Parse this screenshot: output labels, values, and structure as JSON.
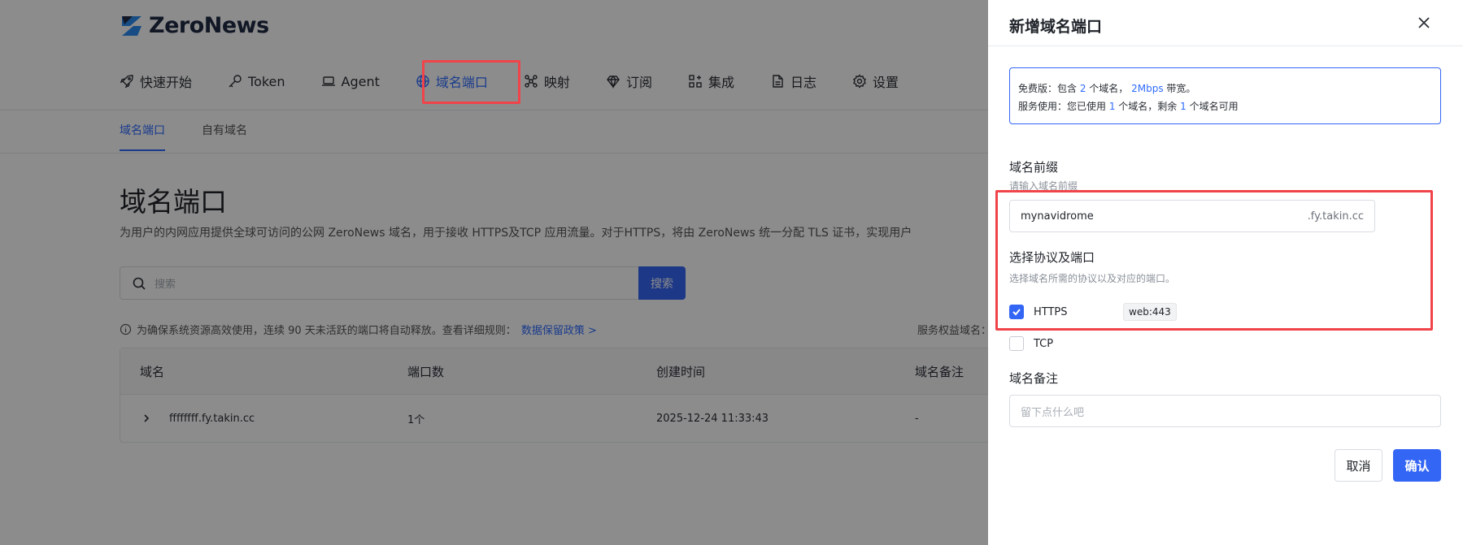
{
  "brand": {
    "name": "ZeroNews"
  },
  "nav": {
    "items": [
      {
        "label": "快速开始",
        "icon": "rocket-icon"
      },
      {
        "label": "Token",
        "icon": "key-icon"
      },
      {
        "label": "Agent",
        "icon": "laptop-icon"
      },
      {
        "label": "域名端口",
        "icon": "globe-icon",
        "active": true
      },
      {
        "label": "映射",
        "icon": "network-icon"
      },
      {
        "label": "订阅",
        "icon": "diamond-icon"
      },
      {
        "label": "集成",
        "icon": "apps-icon"
      },
      {
        "label": "日志",
        "icon": "file-icon"
      },
      {
        "label": "设置",
        "icon": "gear-icon"
      }
    ]
  },
  "subtabs": [
    "域名端口",
    "自有域名"
  ],
  "main": {
    "title": "域名端口",
    "description": "为用户的内网应用提供全球可访问的公网 ZeroNews 域名，用于接收 HTTPS及TCP 应用流量。对于HTTPS，将由 ZeroNews 统一分配 TLS 证书，实现用户",
    "search_placeholder": "搜索",
    "search_button": "搜索",
    "notice": "为确保系统资源高效使用，连续 90 天未活跃的端口将自动释放。查看详细规则：",
    "notice_link": "数据保留政策 >",
    "service_right": "服务权益域名："
  },
  "table": {
    "headers": [
      "域名",
      "端口数",
      "创建时间",
      "域名备注"
    ],
    "rows": [
      {
        "domain": "ffffffff.fy.takin.cc",
        "ports": "1个",
        "created": "2025-12-24 11:33:43",
        "remark": "-"
      }
    ]
  },
  "drawer": {
    "title": "新增域名端口",
    "info_line1": {
      "a": "免费版：包含 ",
      "b": "2",
      "c": " 个域名， ",
      "d": "2Mbps",
      "e": " 带宽。"
    },
    "info_line2": {
      "a": "服务使用：您已使用 ",
      "b": "1",
      "c": " 个域名，剩余 ",
      "d": "1",
      "e": " 个域名可用"
    },
    "prefix_label": "域名前缀",
    "prefix_hint": "请输入域名前缀",
    "prefix_value": "mynavidrome",
    "prefix_suffix": ".fy.takin.cc",
    "protocol_label": "选择协议及端口",
    "protocol_hint": "选择域名所需的协议以及对应的端口。",
    "https_label": "HTTPS",
    "https_checked": true,
    "https_port": "web:443",
    "tcp_label": "TCP",
    "tcp_checked": false,
    "remark_label": "域名备注",
    "remark_placeholder": "留下点什么吧",
    "cancel": "取消",
    "confirm": "确认"
  },
  "colors": {
    "primary": "#3466f6",
    "highlight": "#f0434a"
  }
}
